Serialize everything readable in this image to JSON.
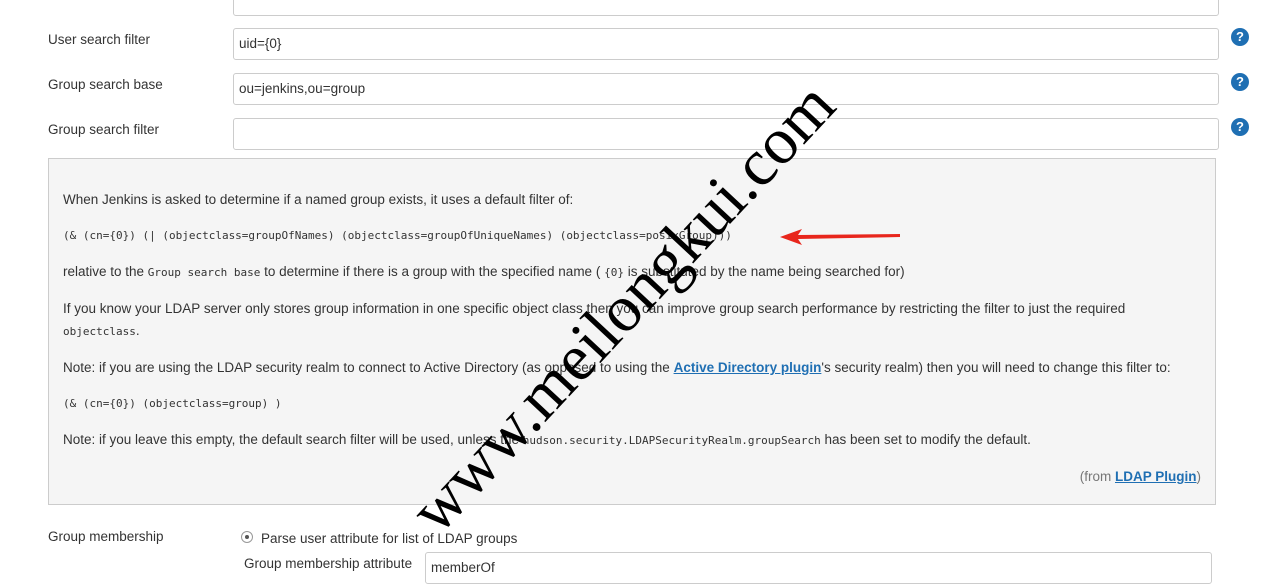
{
  "fields": [
    {
      "label": "User search filter",
      "value": "uid={0}"
    },
    {
      "label": "Group search base",
      "value": "ou=jenkins,ou=group"
    },
    {
      "label": "Group search filter",
      "value": ""
    }
  ],
  "help_icon": "question-circle-icon",
  "help_glyph": "?",
  "help": {
    "p1": "When Jenkins is asked to determine if a named group exists, it uses a default filter of:",
    "filter1": "(& (cn={0}) (| (objectclass=groupOfNames) (objectclass=groupOfUniqueNames) (objectclass=posixGroup)))",
    "p2a": "relative to the ",
    "p2code": "Group search base",
    "p2b": " to determine if there is a group with the specified name ( ",
    "p2code2": "{0}",
    "p2c": " is substituted by the name being searched for)",
    "p3a": "If you know your LDAP server only stores group information in one specific object class then you can improve group search performance by restricting the filter to just the required ",
    "p3code": "objectclass",
    "p3b": ".",
    "p4a": "Note: if you are using the LDAP security realm to connect to Active Directory (as opposed to using the ",
    "p4link": "Active Directory plugin",
    "p4b": "'s security realm) then you will need to change this filter to:",
    "filter2": "(& (cn={0}) (objectclass=group) )",
    "p5a": "Note: if you leave this empty, the default search filter will be used, unless the ",
    "p5code": "hudson.security.LDAPSecurityRealm.groupSearch",
    "p5b": " has been set to modify the default.",
    "from_a": "(from ",
    "from_link": "LDAP Plugin",
    "from_b": ")"
  },
  "membership": {
    "label": "Group membership",
    "radio_label": "Parse user attribute for list of LDAP groups",
    "radio_selected": true,
    "attr_label": "Group membership attribute",
    "attr_value": "memberOf"
  },
  "watermark": "www.meilongkui.com",
  "colors": {
    "arrow": "#e8261c",
    "link": "#1f6fb3",
    "help": "#1f6fb3"
  }
}
